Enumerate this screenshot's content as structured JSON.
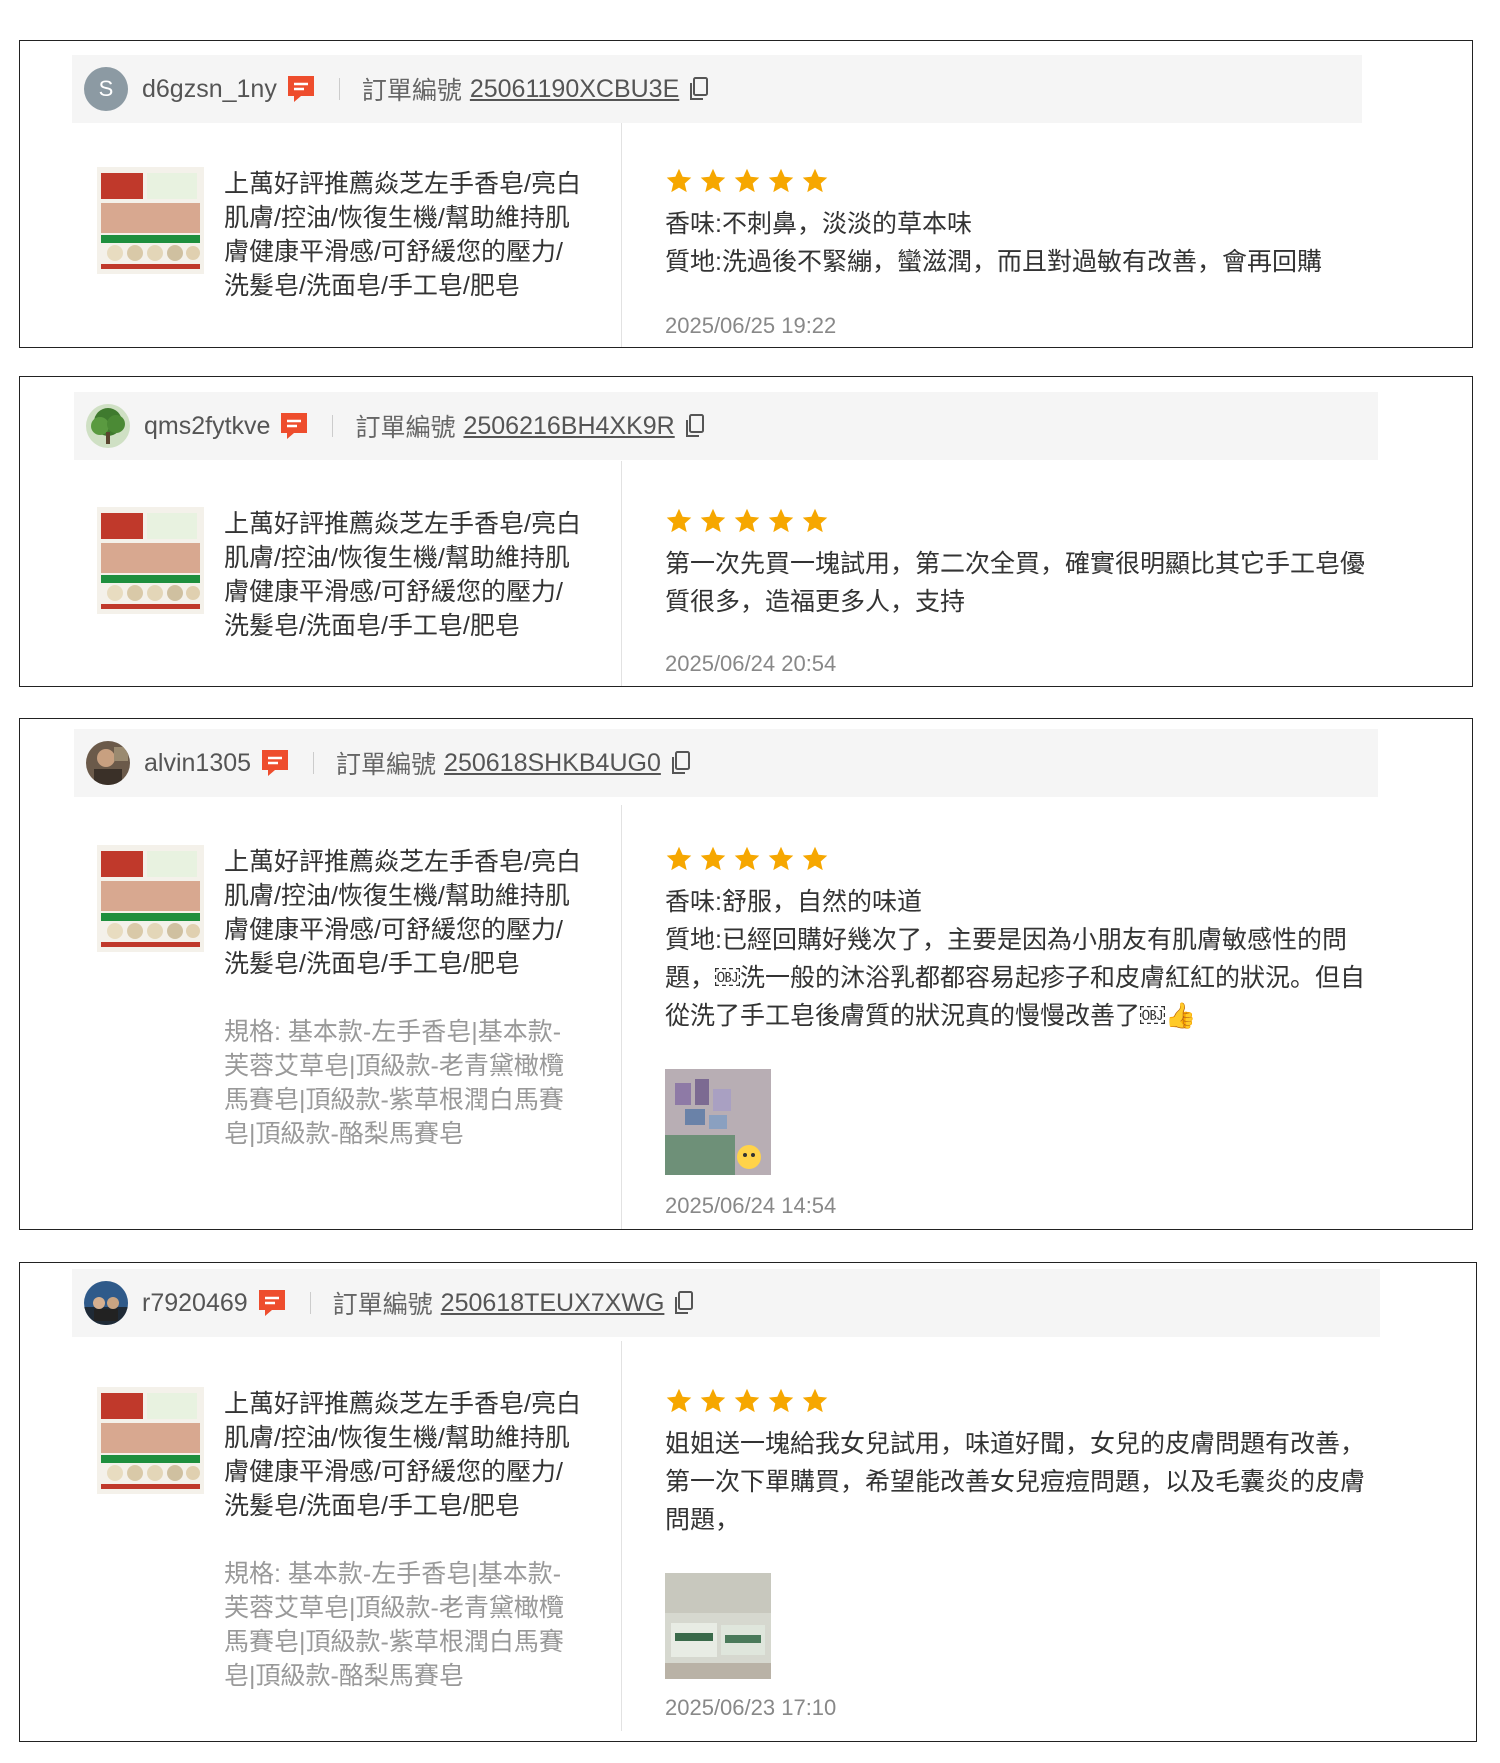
{
  "order_label": "訂單編號",
  "product_title": "上萬好評推薦焱芝左手香皂/亮白肌膚/控油/恢復生機/幫助維持肌膚健康平滑感/可舒緩您的壓力/洗髮皂/洗面皂/手工皂/肥皂",
  "reviews": [
    {
      "avatar_letter": "S",
      "username": "d6gzsn_1ny",
      "order_number": "25061190XCBU3E",
      "rating": 5,
      "comment": "香味:不刺鼻，淡淡的草本味\n質地:洗過後不緊繃，蠻滋潤，而且對過敏有改善，會再回購",
      "date": "2025/06/25 19:22"
    },
    {
      "username": "qms2fytkve",
      "order_number": "2506216BH4XK9R",
      "rating": 5,
      "comment": "第一次先買一塊試用，第二次全買，確實很明顯比其它手工皂優質很多，造福更多人，支持",
      "date": "2025/06/24 20:54"
    },
    {
      "username": "alvin1305",
      "order_number": "250618SHKB4UG0",
      "rating": 5,
      "spec": "規格: 基本款-左手香皂|基本款-芙蓉艾草皂|頂級款-老青黛橄欖馬賽皂|頂級款-紫草根潤白馬賽皂|頂級款-酪梨馬賽皂",
      "comment": "香味:舒服，自然的味道\n質地:已經回購好幾次了，主要是因為小朋友有肌膚敏感性的問題，￼洗一般的沐浴乳都都容易起疹子和皮膚紅紅的狀況。但自從洗了手工皂後膚質的狀況真的慢慢改善了￼👍",
      "date": "2025/06/24 14:54"
    },
    {
      "username": "r7920469",
      "order_number": "250618TEUX7XWG",
      "rating": 5,
      "spec": "規格: 基本款-左手香皂|基本款-芙蓉艾草皂|頂級款-老青黛橄欖馬賽皂|頂級款-紫草根潤白馬賽皂|頂級款-酪梨馬賽皂",
      "comment": "姐姐送一塊給我女兒試用，味道好聞，女兒的皮膚問題有改善，第一次下單購買，希望能改善女兒痘痘問題，以及毛囊炎的皮膚問題，",
      "date": "2025/06/23 17:10"
    }
  ],
  "colors": {
    "star": "#f6a700",
    "chat_icon": "#ee4d2d",
    "header_bg": "#f5f5f5"
  }
}
